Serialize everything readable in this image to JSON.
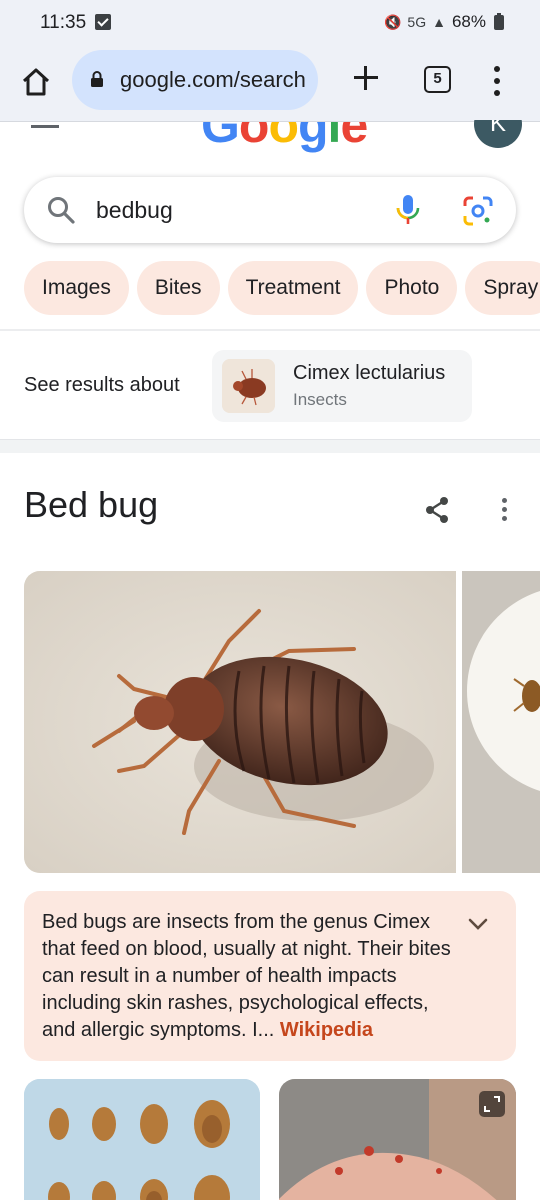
{
  "status_bar": {
    "time": "11:35",
    "network": "5G",
    "battery": "68%"
  },
  "browser": {
    "url": "google.com/search",
    "tab_count": "5"
  },
  "header": {
    "logo_text": "Google",
    "avatar_initial": "K"
  },
  "search": {
    "query": "bedbug"
  },
  "chips": [
    "Images",
    "Bites",
    "Treatment",
    "Photo",
    "Spray"
  ],
  "see_results": {
    "label": "See results about",
    "entity_title": "Cimex lectularius",
    "entity_subtitle": "Insects"
  },
  "knowledge_panel": {
    "title": "Bed bug",
    "description": "Bed bugs are insects from the genus Cimex that feed on blood, usually at night. Their bites can result in a number of health impacts including skin rashes, psychological effects, and allergic symptoms. I...",
    "source_link": "Wikipedia"
  },
  "icons": {
    "home": "home-icon",
    "lock": "lock-icon",
    "new_tab": "plus-icon",
    "menu": "more-vert-icon",
    "search": "search-icon",
    "voice": "mic-icon",
    "lens": "lens-icon",
    "share": "share-icon",
    "expand_description": "chevron-down-icon",
    "expand_image": "expand-icon"
  },
  "colors": {
    "chip_bg": "#fce8e0",
    "link": "#c5461c",
    "url_bar_bg": "#d3e3fd",
    "toolbar_bg": "#eef1f7"
  }
}
